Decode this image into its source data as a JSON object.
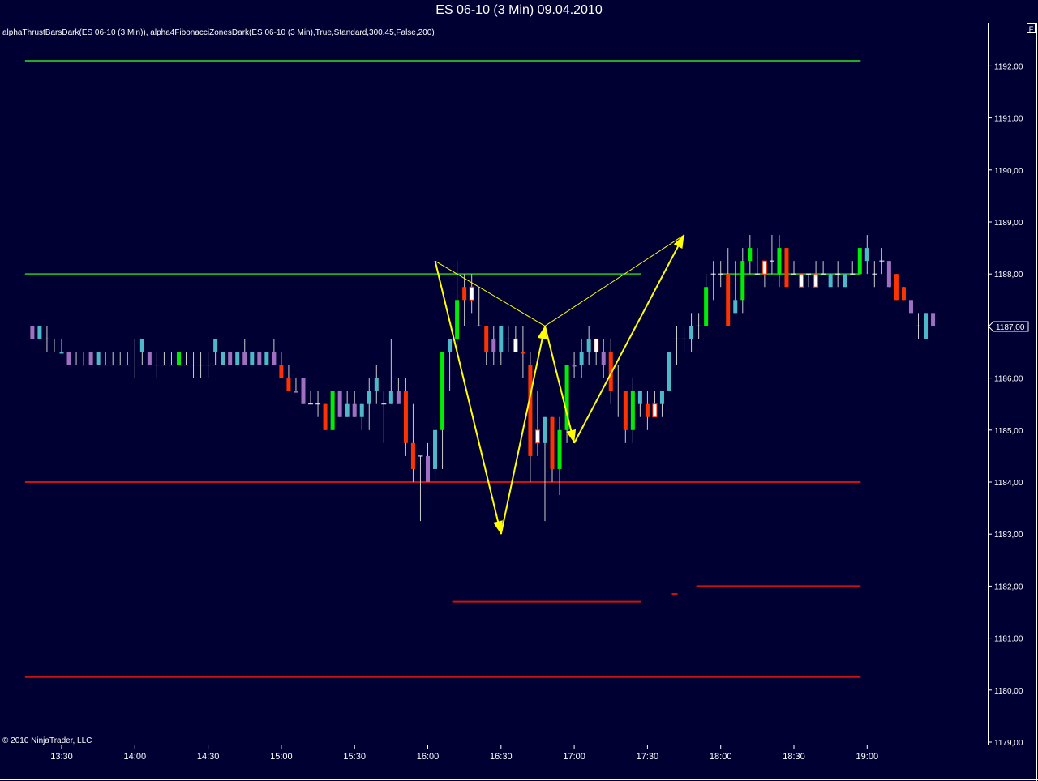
{
  "window": {
    "title": "ES 06-10 (3 Min)  09.04.2010"
  },
  "chart_area": {
    "indicator_label": "alphaThrustBarsDark(ES 06-10 (3 Min)), alpha4FibonacciZonesDark(ES 06-10 (3 Min),True,Standard,300,45,False,200)",
    "copyright": "© 2010 NinjaTrader, LLC",
    "corner_button": "F",
    "last_price_label": "1187,00"
  },
  "colors": {
    "background": "#000033",
    "bull_bar": "#00ee00",
    "bear_bar": "#ff3300",
    "neutral_up": "#4db8c8",
    "neutral_down": "#a070c0",
    "doji": "#ffffff",
    "green_zone": "#22aa22",
    "red_zone": "#cc1111",
    "pattern": "#ffff00"
  },
  "chart_data": {
    "type": "candlestick",
    "title": "ES 06-10 (3 Min)  09.04.2010",
    "x_ticks": [
      "13:30",
      "14:00",
      "14:30",
      "15:00",
      "15:30",
      "16:00",
      "16:30",
      "17:00",
      "17:30",
      "18:00",
      "18:30",
      "19:00"
    ],
    "y_ticks": [
      "1179,00",
      "1180,00",
      "1181,00",
      "1182,00",
      "1183,00",
      "1184,00",
      "1185,00",
      "1186,00",
      "1187,00",
      "1188,00",
      "1189,00",
      "1190,00",
      "1191,00",
      "1192,00"
    ],
    "ylim": [
      1178.9,
      1192.6
    ],
    "start_time": "13:18",
    "bar_minutes": 3,
    "bars": [
      [
        "13:18",
        1187.0,
        1187.0,
        1186.75,
        1186.75,
        "n"
      ],
      [
        "13:21",
        1186.75,
        1187.0,
        1186.75,
        1187.0,
        "u"
      ],
      [
        "13:24",
        1186.75,
        1187.0,
        1186.5,
        1186.75,
        "x"
      ],
      [
        "13:27",
        1186.75,
        1186.75,
        1186.5,
        1186.5,
        "x"
      ],
      [
        "13:30",
        1186.5,
        1186.75,
        1186.5,
        1186.5,
        "u"
      ],
      [
        "13:33",
        1186.5,
        1186.5,
        1186.25,
        1186.25,
        "n"
      ],
      [
        "13:36",
        1186.25,
        1186.5,
        1186.25,
        1186.5,
        "x"
      ],
      [
        "13:39",
        1186.5,
        1186.5,
        1186.25,
        1186.25,
        "x"
      ],
      [
        "13:42",
        1186.5,
        1186.5,
        1186.25,
        1186.25,
        "n"
      ],
      [
        "13:45",
        1186.25,
        1186.5,
        1186.25,
        1186.5,
        "u"
      ],
      [
        "13:48",
        1186.5,
        1186.5,
        1186.25,
        1186.25,
        "x"
      ],
      [
        "13:51",
        1186.5,
        1186.5,
        1186.25,
        1186.25,
        "x"
      ],
      [
        "13:54",
        1186.5,
        1186.5,
        1186.25,
        1186.25,
        "x"
      ],
      [
        "13:57",
        1186.5,
        1186.5,
        1186.25,
        1186.25,
        "x"
      ],
      [
        "14:00",
        1186.25,
        1186.75,
        1186.0,
        1186.5,
        "x"
      ],
      [
        "14:03",
        1186.5,
        1186.75,
        1186.25,
        1186.75,
        "u"
      ],
      [
        "14:06",
        1186.5,
        1186.5,
        1186.25,
        1186.25,
        "n"
      ],
      [
        "14:09",
        1186.5,
        1186.5,
        1186.0,
        1186.25,
        "x"
      ],
      [
        "14:12",
        1186.5,
        1186.5,
        1186.25,
        1186.25,
        "x"
      ],
      [
        "14:15",
        1186.5,
        1186.5,
        1186.25,
        1186.25,
        "x"
      ],
      [
        "14:18",
        1186.25,
        1186.5,
        1186.25,
        1186.5,
        "b"
      ],
      [
        "14:21",
        1186.5,
        1186.5,
        1186.25,
        1186.25,
        "x"
      ],
      [
        "14:24",
        1186.5,
        1186.5,
        1186.0,
        1186.25,
        "x"
      ],
      [
        "14:27",
        1186.5,
        1186.5,
        1186.0,
        1186.25,
        "x"
      ],
      [
        "14:30",
        1186.5,
        1186.5,
        1186.0,
        1186.25,
        "x"
      ],
      [
        "14:33",
        1186.5,
        1186.75,
        1186.25,
        1186.75,
        "u"
      ],
      [
        "14:36",
        1186.25,
        1186.5,
        1186.25,
        1186.5,
        "u"
      ],
      [
        "14:39",
        1186.5,
        1186.5,
        1186.25,
        1186.25,
        "n"
      ],
      [
        "14:42",
        1186.25,
        1186.5,
        1186.25,
        1186.5,
        "u"
      ],
      [
        "14:45",
        1186.5,
        1186.75,
        1186.25,
        1186.25,
        "n"
      ],
      [
        "14:48",
        1186.25,
        1186.5,
        1186.25,
        1186.5,
        "u"
      ],
      [
        "14:51",
        1186.5,
        1186.5,
        1186.25,
        1186.25,
        "n"
      ],
      [
        "14:54",
        1186.25,
        1186.5,
        1186.25,
        1186.5,
        "u"
      ],
      [
        "14:57",
        1186.5,
        1186.75,
        1186.25,
        1186.25,
        "n"
      ],
      [
        "15:00",
        1186.25,
        1186.5,
        1186.0,
        1186.0,
        "d"
      ],
      [
        "15:03",
        1186.0,
        1186.25,
        1185.75,
        1185.75,
        "d"
      ],
      [
        "15:06",
        1185.75,
        1186.0,
        1185.75,
        1185.75,
        "n"
      ],
      [
        "15:09",
        1186.0,
        1186.0,
        1185.5,
        1185.5,
        "n"
      ],
      [
        "15:12",
        1185.75,
        1185.75,
        1185.5,
        1185.5,
        "x"
      ],
      [
        "15:15",
        1185.5,
        1185.75,
        1185.25,
        1185.5,
        "x"
      ],
      [
        "15:18",
        1185.5,
        1185.5,
        1185.0,
        1185.0,
        "d"
      ],
      [
        "15:21",
        1185.0,
        1185.75,
        1185.0,
        1185.75,
        "b"
      ],
      [
        "15:24",
        1185.75,
        1185.75,
        1185.25,
        1185.25,
        "n"
      ],
      [
        "15:27",
        1185.25,
        1185.75,
        1185.25,
        1185.5,
        "u"
      ],
      [
        "15:30",
        1185.5,
        1185.75,
        1185.25,
        1185.25,
        "n"
      ],
      [
        "15:33",
        1185.25,
        1185.5,
        1185.0,
        1185.5,
        "u"
      ],
      [
        "15:36",
        1185.5,
        1186.0,
        1185.0,
        1185.75,
        "u"
      ],
      [
        "15:39",
        1185.75,
        1186.25,
        1185.5,
        1186.0,
        "u"
      ],
      [
        "15:42",
        1185.75,
        1185.75,
        1184.75,
        1185.5,
        "x"
      ],
      [
        "15:45",
        1185.5,
        1186.75,
        1185.5,
        1185.75,
        "u"
      ],
      [
        "15:48",
        1185.75,
        1186.0,
        1185.5,
        1185.5,
        "n"
      ],
      [
        "15:51",
        1185.75,
        1186.0,
        1184.5,
        1184.75,
        "d"
      ],
      [
        "15:54",
        1184.75,
        1185.5,
        1184.0,
        1184.25,
        "d"
      ],
      [
        "15:57",
        1184.25,
        1184.5,
        1183.25,
        1184.5,
        "x"
      ],
      [
        "16:00",
        1184.5,
        1184.75,
        1184.0,
        1184.0,
        "n"
      ],
      [
        "16:03",
        1184.25,
        1185.25,
        1184.0,
        1185.0,
        "u"
      ],
      [
        "16:06",
        1185.0,
        1186.5,
        1184.25,
        1186.5,
        "b"
      ],
      [
        "16:09",
        1186.5,
        1186.75,
        1185.75,
        1186.75,
        "u"
      ],
      [
        "16:12",
        1186.75,
        1188.25,
        1186.5,
        1187.5,
        "b"
      ],
      [
        "16:15",
        1187.5,
        1188.0,
        1187.0,
        1187.75,
        "d"
      ],
      [
        "16:18",
        1187.5,
        1188.0,
        1187.25,
        1187.75,
        "w"
      ],
      [
        "16:21",
        1187.5,
        1187.75,
        1187.0,
        1187.0,
        "x"
      ],
      [
        "16:24",
        1187.0,
        1187.0,
        1186.25,
        1186.5,
        "d"
      ],
      [
        "16:27",
        1186.75,
        1187.0,
        1186.25,
        1186.5,
        "n"
      ],
      [
        "16:30",
        1186.5,
        1187.0,
        1186.25,
        1187.0,
        "u"
      ],
      [
        "16:33",
        1186.5,
        1187.0,
        1186.5,
        1186.75,
        "x"
      ],
      [
        "16:36",
        1186.5,
        1187.0,
        1186.5,
        1186.75,
        "w"
      ],
      [
        "16:39",
        1186.5,
        1187.0,
        1186.0,
        1186.5,
        "d"
      ],
      [
        "16:42",
        1186.25,
        1186.5,
        1184.0,
        1184.5,
        "d"
      ],
      [
        "16:45",
        1185.0,
        1185.75,
        1184.5,
        1184.75,
        "w"
      ],
      [
        "16:48",
        1184.75,
        1185.25,
        1183.25,
        1185.25,
        "u"
      ],
      [
        "16:51",
        1185.25,
        1185.25,
        1184.0,
        1184.25,
        "d"
      ],
      [
        "16:54",
        1184.25,
        1185.25,
        1183.75,
        1185.0,
        "b"
      ],
      [
        "16:57",
        1185.0,
        1186.25,
        1184.75,
        1186.25,
        "b"
      ],
      [
        "17:00",
        1186.25,
        1186.5,
        1186.0,
        1186.25,
        "n"
      ],
      [
        "17:03",
        1186.25,
        1186.75,
        1186.0,
        1186.5,
        "u"
      ],
      [
        "17:06",
        1186.5,
        1187.0,
        1186.25,
        1186.75,
        "u"
      ],
      [
        "17:09",
        1186.75,
        1186.75,
        1186.25,
        1186.5,
        "w"
      ],
      [
        "17:12",
        1186.5,
        1186.75,
        1186.0,
        1186.25,
        "n"
      ],
      [
        "17:15",
        1186.5,
        1186.75,
        1185.5,
        1185.75,
        "d"
      ],
      [
        "17:18",
        1186.0,
        1186.25,
        1185.25,
        1186.25,
        "x"
      ],
      [
        "17:21",
        1185.75,
        1185.75,
        1184.75,
        1185.0,
        "d"
      ],
      [
        "17:24",
        1185.0,
        1186.0,
        1184.75,
        1185.75,
        "b"
      ],
      [
        "17:27",
        1185.75,
        1185.75,
        1185.25,
        1185.5,
        "u"
      ],
      [
        "17:30",
        1185.25,
        1185.75,
        1185.0,
        1185.5,
        "d"
      ],
      [
        "17:33",
        1185.25,
        1185.75,
        1185.25,
        1185.5,
        "w"
      ],
      [
        "17:36",
        1185.5,
        1185.75,
        1185.25,
        1185.75,
        "u"
      ],
      [
        "17:39",
        1185.75,
        1186.5,
        1185.75,
        1186.5,
        "u"
      ],
      [
        "17:42",
        1186.5,
        1187.0,
        1186.25,
        1186.75,
        "x"
      ],
      [
        "17:45",
        1186.75,
        1187.0,
        1186.5,
        1186.75,
        "x"
      ],
      [
        "17:48",
        1186.75,
        1187.25,
        1186.5,
        1187.0,
        "u"
      ],
      [
        "17:51",
        1187.0,
        1187.25,
        1186.75,
        1187.0,
        "x"
      ],
      [
        "17:54",
        1187.0,
        1188.0,
        1187.0,
        1187.75,
        "b"
      ],
      [
        "17:57",
        1187.75,
        1188.25,
        1187.5,
        1188.0,
        "x"
      ],
      [
        "18:00",
        1188.0,
        1188.25,
        1187.75,
        1188.0,
        "x"
      ],
      [
        "18:03",
        1188.0,
        1188.5,
        1187.0,
        1187.0,
        "d"
      ],
      [
        "18:06",
        1187.25,
        1188.25,
        1187.25,
        1187.5,
        "u"
      ],
      [
        "18:09",
        1187.5,
        1188.5,
        1187.25,
        1188.25,
        "b"
      ],
      [
        "18:12",
        1188.25,
        1188.75,
        1188.0,
        1188.5,
        "b"
      ],
      [
        "18:15",
        1188.25,
        1188.5,
        1188.0,
        1188.0,
        "x"
      ],
      [
        "18:18",
        1188.0,
        1188.25,
        1187.75,
        1188.25,
        "w"
      ],
      [
        "18:21",
        1188.5,
        1188.75,
        1188.0,
        1188.25,
        "x"
      ],
      [
        "18:24",
        1188.0,
        1188.75,
        1187.75,
        1188.5,
        "b"
      ],
      [
        "18:27",
        1188.5,
        1188.5,
        1187.75,
        1187.75,
        "d"
      ],
      [
        "18:30",
        1188.0,
        1188.25,
        1188.0,
        1188.0,
        "x"
      ],
      [
        "18:33",
        1188.0,
        1188.0,
        1187.75,
        1187.75,
        "w"
      ],
      [
        "18:36",
        1187.75,
        1188.0,
        1187.75,
        1188.0,
        "x"
      ],
      [
        "18:39",
        1188.0,
        1188.25,
        1187.75,
        1187.75,
        "w"
      ],
      [
        "18:42",
        1188.0,
        1188.25,
        1188.0,
        1188.0,
        "x"
      ],
      [
        "18:45",
        1188.0,
        1188.0,
        1187.75,
        1187.75,
        "u"
      ],
      [
        "18:48",
        1187.75,
        1188.25,
        1187.75,
        1188.0,
        "x"
      ],
      [
        "18:51",
        1187.75,
        1188.0,
        1187.75,
        1188.0,
        "u"
      ],
      [
        "18:54",
        1188.0,
        1188.25,
        1188.0,
        1188.0,
        "x"
      ],
      [
        "18:57",
        1188.0,
        1188.5,
        1188.0,
        1188.5,
        "b"
      ],
      [
        "19:00",
        1188.25,
        1188.75,
        1188.0,
        1188.5,
        "u"
      ],
      [
        "19:03",
        1188.0,
        1188.25,
        1187.75,
        1188.0,
        "x"
      ],
      [
        "19:06",
        1188.25,
        1188.5,
        1188.0,
        1188.25,
        "x"
      ],
      [
        "19:09",
        1188.25,
        1188.25,
        1187.75,
        1187.75,
        "n"
      ],
      [
        "19:12",
        1188.0,
        1188.0,
        1187.5,
        1187.5,
        "d"
      ],
      [
        "19:15",
        1187.75,
        1187.75,
        1187.5,
        1187.5,
        "d"
      ],
      [
        "19:18",
        1187.5,
        1187.5,
        1187.25,
        1187.25,
        "n"
      ],
      [
        "19:21",
        1187.0,
        1187.25,
        1186.75,
        1187.0,
        "x"
      ],
      [
        "19:24",
        1186.75,
        1187.25,
        1186.75,
        1187.25,
        "u"
      ],
      [
        "19:27",
        1187.25,
        1187.25,
        1187.0,
        1187.0,
        "n"
      ]
    ],
    "horizontal_lines": [
      {
        "price": 1192.1,
        "from": "13:15",
        "to": "19:00",
        "color": "green"
      },
      {
        "price": 1188.0,
        "from": "13:15",
        "to": "17:30",
        "color": "green"
      },
      {
        "price": 1188.0,
        "from": "18:00",
        "to": "19:00",
        "color": "green"
      },
      {
        "price": 1184.0,
        "from": "13:15",
        "to": "19:00",
        "color": "red"
      },
      {
        "price": 1181.7,
        "from": "16:10",
        "to": "17:30",
        "color": "red"
      },
      {
        "price": 1181.85,
        "from": "17:40",
        "to": "17:45",
        "color": "red"
      },
      {
        "price": 1182.0,
        "from": "17:50",
        "to": "19:00",
        "color": "red"
      },
      {
        "price": 1180.25,
        "from": "13:15",
        "to": "19:00",
        "color": "red"
      }
    ],
    "pattern_lines": [
      {
        "from": [
          "16:03",
          1188.25
        ],
        "to": [
          "16:30",
          1183.0
        ],
        "arrow": true
      },
      {
        "from": [
          "16:30",
          1183.0
        ],
        "to": [
          "16:48",
          1187.0
        ],
        "arrow": true
      },
      {
        "from": [
          "16:48",
          1187.0
        ],
        "to": [
          "17:00",
          1184.75
        ],
        "arrow": true
      },
      {
        "from": [
          "17:00",
          1184.75
        ],
        "to": [
          "17:45",
          1188.75
        ],
        "arrow": true
      },
      {
        "from": [
          "16:03",
          1188.25
        ],
        "to": [
          "16:48",
          1187.0
        ],
        "arrow": false
      },
      {
        "from": [
          "16:48",
          1187.0
        ],
        "to": [
          "17:45",
          1188.75
        ],
        "arrow": false
      }
    ],
    "grid": false
  }
}
